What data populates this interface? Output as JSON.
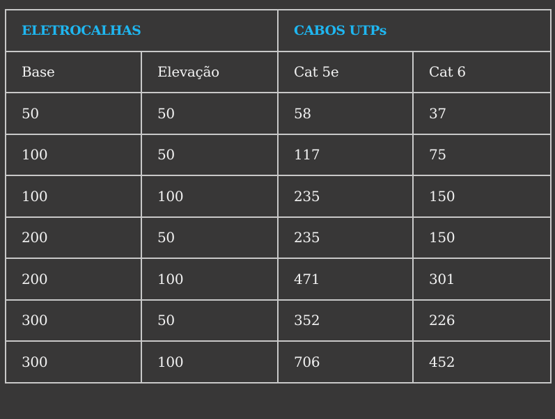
{
  "table": {
    "group_headers": [
      "ELETROCALHAS",
      "CABOS UTPs"
    ],
    "column_headers": [
      "Base",
      "Elevação",
      "Cat 5e",
      "Cat 6"
    ],
    "rows": [
      [
        "50",
        "50",
        "58",
        "37"
      ],
      [
        "100",
        "50",
        "117",
        "75"
      ],
      [
        "100",
        "100",
        "235",
        "150"
      ],
      [
        "200",
        "50",
        "235",
        "150"
      ],
      [
        "200",
        "100",
        "471",
        "301"
      ],
      [
        "300",
        "50",
        "352",
        "226"
      ],
      [
        "300",
        "100",
        "706",
        "452"
      ]
    ],
    "colors": {
      "background": "#383737",
      "border": "#c9c9c9",
      "group_header_text": "#1fb6f0",
      "body_text": "#f2f2f2"
    }
  }
}
